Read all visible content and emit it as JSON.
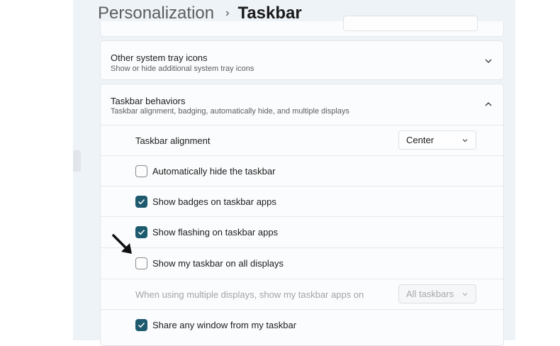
{
  "breadcrumb": {
    "parent": "Personalization",
    "separator": "›",
    "current": "Taskbar"
  },
  "other_tray": {
    "title": "Other system tray icons",
    "subtitle": "Show or hide additional system tray icons",
    "expanded": false
  },
  "behaviors": {
    "title": "Taskbar behaviors",
    "subtitle": "Taskbar alignment, badging, automatically hide, and multiple displays",
    "expanded": true,
    "alignment_label": "Taskbar alignment",
    "alignment_value": "Center",
    "auto_hide": {
      "label": "Automatically hide the taskbar",
      "checked": false
    },
    "badges": {
      "label": "Show badges on taskbar apps",
      "checked": true
    },
    "flashing": {
      "label": "Show flashing on taskbar apps",
      "checked": true
    },
    "all_displays": {
      "label": "Show my taskbar on all displays",
      "checked": false
    },
    "multi_display_label": "When using multiple displays, show my taskbar apps on",
    "multi_display_value": "All taskbars",
    "share_window": {
      "label": "Share any window from my taskbar",
      "checked": true
    }
  },
  "colors": {
    "accent": "#1e5a6e",
    "window_bg": "#eef3f8",
    "card_bg": "#fbfcfd"
  }
}
